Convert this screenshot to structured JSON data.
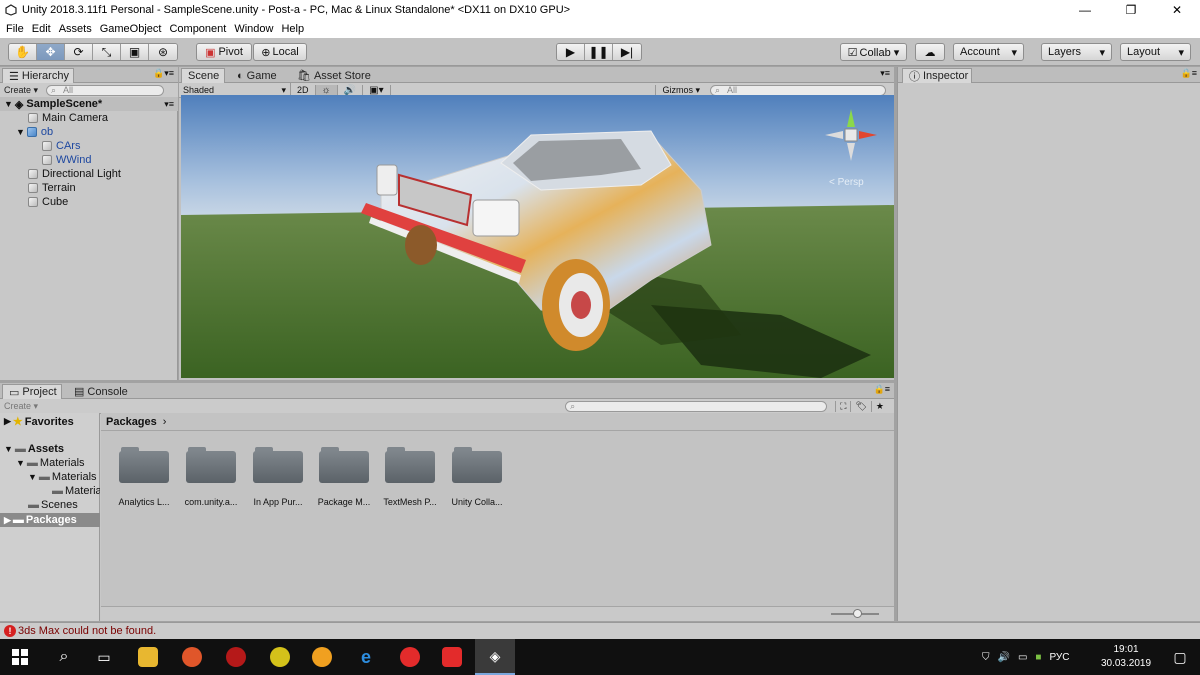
{
  "window": {
    "title": "Unity 2018.3.11f1 Personal - SampleScene.unity - Post-a - PC, Mac & Linux Standalone* <DX11 on DX10 GPU>",
    "minimize": "—",
    "maximize": "❐",
    "close": "✕"
  },
  "menu": [
    "File",
    "Edit",
    "Assets",
    "GameObject",
    "Component",
    "Window",
    "Help"
  ],
  "toolbar": {
    "tools": [
      "hand-icon",
      "move-icon",
      "rotate-icon",
      "scale-icon",
      "rect-icon",
      "transform-icon"
    ],
    "pivot_label": "Pivot",
    "local_label": "Local",
    "collab_label": "Collab ▾",
    "account_label": "Account",
    "layers_label": "Layers",
    "layout_label": "Layout"
  },
  "hierarchy": {
    "tab": "Hierarchy",
    "create": "Create ▾",
    "search_placeholder": "All",
    "scene_name": "SampleScene*",
    "items": [
      {
        "label": "Main Camera",
        "indent": 1
      },
      {
        "label": "ob",
        "indent": 1
      },
      {
        "label": "CArs",
        "indent": 2
      },
      {
        "label": "WWind",
        "indent": 2
      },
      {
        "label": "Directional Light",
        "indent": 1
      },
      {
        "label": "Terrain",
        "indent": 1
      },
      {
        "label": "Cube",
        "indent": 1
      }
    ]
  },
  "scene": {
    "tabs": [
      "Scene",
      "Game",
      "Asset Store"
    ],
    "shading": "Shaded",
    "mode_2d": "2D",
    "gizmos": "Gizmos ▾",
    "search_placeholder": "All",
    "persp": "< Persp"
  },
  "inspector": {
    "tab": "Inspector"
  },
  "project": {
    "tabs": [
      "Project",
      "Console"
    ],
    "create": "Create ▾",
    "favorites": "Favorites",
    "tree": [
      {
        "label": "Assets",
        "indent": 0,
        "bold": true
      },
      {
        "label": "Materials",
        "indent": 1
      },
      {
        "label": "Materials",
        "indent": 2
      },
      {
        "label": "Materia",
        "indent": 3
      },
      {
        "label": "Scenes",
        "indent": 1
      },
      {
        "label": "Packages",
        "indent": 0,
        "bold": true,
        "selected": true
      }
    ],
    "breadcrumb": "Packages",
    "folders": [
      "Analytics L...",
      "com.unity.a...",
      "In App Pur...",
      "Package M...",
      "TextMesh P...",
      "Unity Colla..."
    ]
  },
  "status": {
    "message": "3ds Max could not be found."
  },
  "taskbar": {
    "lang": "РУС",
    "time": "19:01",
    "date": "30.03.2019"
  }
}
